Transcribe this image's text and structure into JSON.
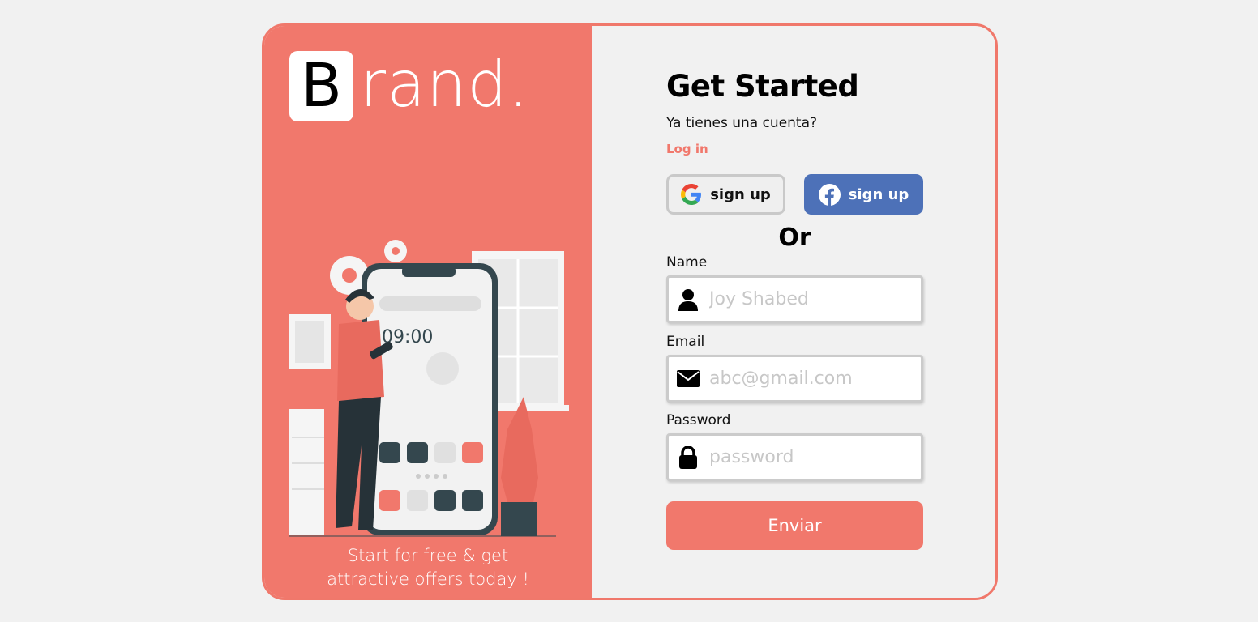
{
  "brand": {
    "initial": "B",
    "rest": "rand."
  },
  "tagline": {
    "line1": "Start for free & get",
    "line2": "attractive offers today !"
  },
  "phone": {
    "time": "09:00"
  },
  "form": {
    "title": "Get Started",
    "subtitle": "Ya tienes una cuenta?",
    "login_link": "Log in",
    "google_label": "sign up",
    "facebook_label": "sign up",
    "or_text": "Or",
    "name_label": "Name",
    "name_placeholder": "Joy Shabed",
    "email_label": "Email",
    "email_placeholder": "abc@gmail.com",
    "password_label": "Password",
    "password_placeholder": "password",
    "submit_label": "Enviar"
  },
  "colors": {
    "accent": "#f1786c",
    "facebook": "#4d71b8",
    "background": "#f1f1f1"
  },
  "icons": [
    "google-icon",
    "facebook-icon",
    "user-icon",
    "envelope-icon",
    "lock-icon"
  ]
}
